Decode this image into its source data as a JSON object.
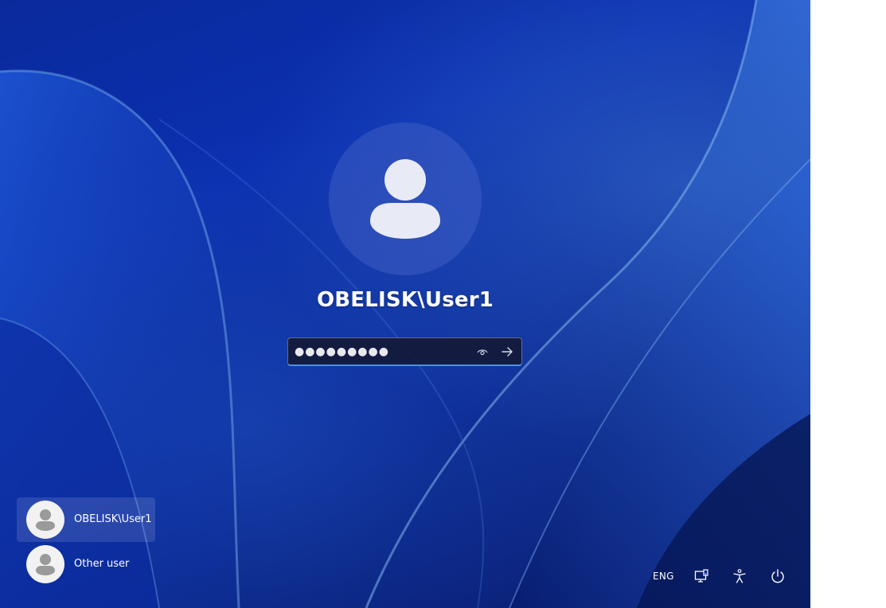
{
  "lock_screen": {
    "user_name": "OBELISK\\User1",
    "password": {
      "masked_value": "●●●●●●●●●",
      "reveal_icon": "eye-icon",
      "submit_icon": "arrow-right-icon"
    }
  },
  "user_list": [
    {
      "label": "OBELISK\\User1",
      "icon": "user-icon",
      "selected": true
    },
    {
      "label": "Other user",
      "icon": "user-icon",
      "selected": false
    }
  ],
  "tray": {
    "language": "ENG",
    "network_icon": "network-icon",
    "accessibility_icon": "accessibility-icon",
    "power_icon": "power-icon"
  },
  "colors": {
    "background": "#0a2a9c",
    "accent": "#4c8fe6",
    "text": "#ffffff"
  }
}
